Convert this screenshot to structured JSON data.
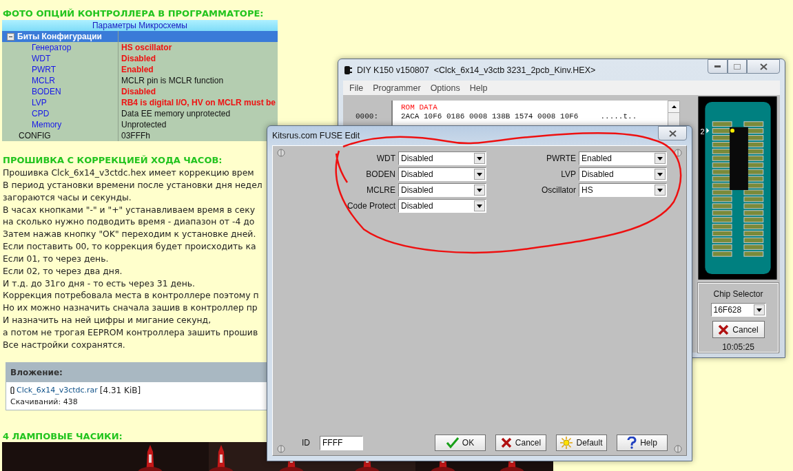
{
  "page": {
    "heading": "ФОТО ОПЦИЙ КОНТРОЛЛЕРА В ПРОГРАММАТОРЕ:",
    "config_table": {
      "title": "Параметры Микросхемы",
      "group": {
        "label": "Биты Конфигурации",
        "expanded": true
      },
      "rows": [
        {
          "name": "Генератор",
          "value": "HS oscillator",
          "highlighted": true
        },
        {
          "name": "WDT",
          "value": "Disabled",
          "highlighted": true
        },
        {
          "name": "PWRT",
          "value": "Enabled",
          "highlighted": true
        },
        {
          "name": "MCLR",
          "value": "MCLR pin is MCLR function",
          "highlighted": false
        },
        {
          "name": "BODEN",
          "value": "Disabled",
          "highlighted": true
        },
        {
          "name": "LVP",
          "value": "RB4 is digital I/O, HV on MCLR must be",
          "highlighted": true
        },
        {
          "name": "CPD",
          "value": "Data EE memory unprotected",
          "highlighted": false
        },
        {
          "name": "Memory",
          "value": "Unprotected",
          "highlighted": false
        }
      ],
      "config": {
        "name": "CONFIG",
        "value": "03FFFh"
      }
    },
    "section_heading": "ПРОШИВКА С КОРРЕКЦИЕЙ ХОДА ЧАСОВ:",
    "paragraph_lines": [
      "Прошивка Clck_6x14_v3ctdc.hex имеет коррекцию врем",
      "В период установки времени после установки дня недел",
      "загораются часы и секунды.",
      "В часах кнопками \"-\" и \"+\" устанавливаем время в секу",
      "на сколько нужно подводить время - диапазон от -4 до",
      "Затем нажав кнопку \"OK\" переходим к установке дней.",
      "Если поставить 00, то коррекция будет происходить ка",
      "Если 01, то через день.",
      "Если 02, то через два дня.",
      "И т.д. до 31го дня - то есть через 31 день.",
      "Коррекция потребовала места в контроллере поэтому п",
      "Но их можно назначить сначала зашив в контроллер пр",
      "И назначить на ней цифры и мигание секунд,",
      "а потом не трогая EEPROM контроллера зашить прошив",
      "Все настройки сохранятся."
    ],
    "attachment": {
      "title": "Вложение:",
      "file": "Clck_6x14_v3ctdc.rar",
      "size": "[4.31 KiB]",
      "downloads": "Скачиваний: 438"
    },
    "photo_heading": "4 ЛАМПОВЫЕ ЧАСИКИ:"
  },
  "programmer_window": {
    "title": "DIY K150 v150807  <Clck_6x14_v3ctb 3231_2pcb_Kinv.HEX>",
    "menu": [
      "File",
      "Programmer",
      "Options",
      "Help"
    ],
    "hex": {
      "heading": "ROM DATA",
      "rows": [
        {
          "address": "0000:",
          "data": "2ACA 10F6 0186 0008 138B 1574 0008 10F6",
          "ascii": ".....t.."
        }
      ]
    },
    "socket": {
      "pin_label": "2"
    },
    "chip_selector": {
      "label": "Chip Selector",
      "value": "16F628"
    },
    "cancel_button": "Cancel",
    "clock": "10:05:25"
  },
  "fuse_dialog": {
    "title": "Kitsrus.com FUSE Edit",
    "left_fields": [
      {
        "label": "WDT",
        "value": "Disabled"
      },
      {
        "label": "BODEN",
        "value": "Disabled"
      },
      {
        "label": "MCLRE",
        "value": "Disabled"
      },
      {
        "label": "Code Protect",
        "value": "Disabled"
      }
    ],
    "right_fields": [
      {
        "label": "PWRTE",
        "value": "Enabled"
      },
      {
        "label": "LVP",
        "value": "Disabled"
      },
      {
        "label": "Oscillator",
        "value": "HS"
      }
    ],
    "id": {
      "label": "ID",
      "value": "FFFF"
    },
    "buttons": [
      {
        "kind": "ok",
        "label": "OK"
      },
      {
        "kind": "cancel",
        "label": "Cancel"
      },
      {
        "kind": "default",
        "label": "Default"
      },
      {
        "kind": "help",
        "label": "Help"
      }
    ]
  }
}
